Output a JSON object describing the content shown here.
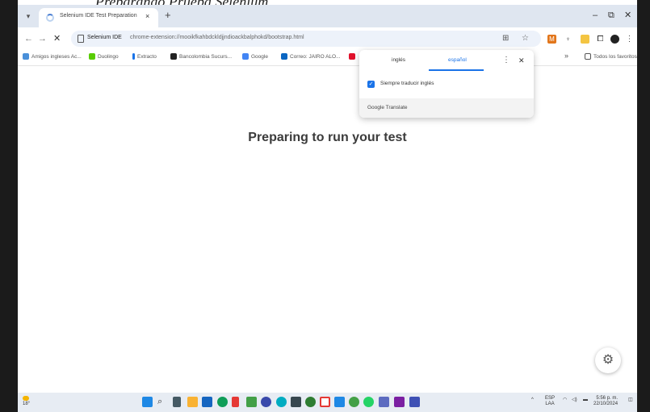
{
  "caption": "Preparando Prueba Selenium",
  "browser": {
    "tab_title": "Selenium IDE Test Preparation",
    "url_origin": "Selenium IDE",
    "url_path": "chrome-extension://mooikfkahbdckldjjndioackbalphokd/bootstrap.html",
    "new_tab_glyph": "+",
    "close_glyph": "×",
    "minimize_glyph": "–",
    "maximize_glyph": "⧉",
    "window_close_glyph": "✕"
  },
  "bookmarks": [
    {
      "label": "Amigos ingleses Ac...",
      "color": "#4a90d9"
    },
    {
      "label": "Duolingo",
      "color": "#58cc02"
    },
    {
      "label": "Extracto",
      "color": "#1a73e8"
    },
    {
      "label": "Bancolombia Sucurs...",
      "color": "#222222"
    },
    {
      "label": "Google",
      "color": "#4285f4"
    },
    {
      "label": "Correo: JAIRO ALO...",
      "color": "#0a66c2"
    }
  ],
  "bookmarks_more": "»",
  "all_bookmarks": "Todos los favoritos",
  "translate": {
    "lang_source": "inglés",
    "lang_target": "español",
    "always_translate": "Siempre traducir inglés",
    "footer": "Google Translate",
    "colors": {
      "accent": "#1a73e8"
    }
  },
  "page": {
    "heading": "Preparing to run your test"
  },
  "taskbar": {
    "weather": "18°",
    "lang_top": "ESP",
    "lang_bottom": "LAA",
    "time": "5:56 p. m.",
    "date": "22/10/2024"
  }
}
